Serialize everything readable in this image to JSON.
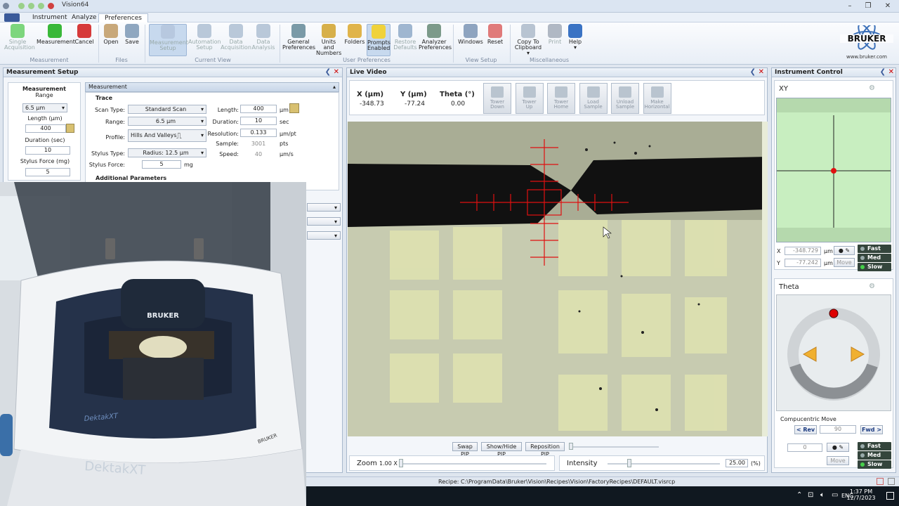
{
  "window": {
    "title": "Vision64"
  },
  "menu": [
    "Instrument",
    "Analyze",
    "Preferences"
  ],
  "ribbon": {
    "buttons": [
      {
        "label": "Single\nAcquisition",
        "color": "#7dd67d",
        "dis": true
      },
      {
        "label": "Measurement",
        "color": "#39b839"
      },
      {
        "label": "Cancel",
        "color": "#d63a3a"
      },
      {
        "label": "Open",
        "color": "#c8a87a"
      },
      {
        "label": "Save",
        "color": "#8fa7c0"
      },
      {
        "label": "Measurement\nSetup",
        "color": "#b7c8df",
        "dis": true,
        "active": true
      },
      {
        "label": "Automation\nSetup",
        "color": "#b9c8d9",
        "dis": true
      },
      {
        "label": "Data\nAcquisition",
        "color": "#b9c8d9",
        "dis": true
      },
      {
        "label": "Data\nAnalysis",
        "color": "#b9c8d9",
        "dis": true
      },
      {
        "label": "General\nPreferences",
        "color": "#7a9aa7"
      },
      {
        "label": "Units and\nNumbers",
        "color": "#d7b04a"
      },
      {
        "label": "Folders",
        "color": "#e0b44a"
      },
      {
        "label": "Prompts\nEnabled",
        "color": "#f0d23a",
        "active": true
      },
      {
        "label": "Restore\nDefaults",
        "color": "#9fb6d0",
        "dis": true
      },
      {
        "label": "Analyzer\nPreferences",
        "color": "#7c9a8a"
      },
      {
        "label": "Windows",
        "color": "#8ea4c0"
      },
      {
        "label": "Reset",
        "color": "#e07a7a"
      },
      {
        "label": "Copy To\nClipboard ▾",
        "color": "#b8c4d2"
      },
      {
        "label": "Print",
        "color": "#b0b8c4",
        "dis": true
      },
      {
        "label": "Help\n▾",
        "color": "#3a73c4"
      }
    ],
    "groups": [
      "Measurement",
      "Files",
      "Current View",
      "User Preferences",
      "View Setup",
      "Miscellaneous"
    ]
  },
  "logo": {
    "text": "BRUKER",
    "url": "www.bruker.com"
  },
  "measurement_setup": {
    "title": "Measurement Setup",
    "side": {
      "title": "Measurement",
      "range_label": "Range",
      "range_value": "6.5 µm",
      "length_label": "Length (µm)",
      "length_value": "400",
      "duration_label": "Duration (sec)",
      "duration_value": "10",
      "stylus_label": "Stylus Force (mg)",
      "stylus_value": "5"
    },
    "section": "Measurement",
    "trace": "Trace",
    "scan_type_label": "Scan Type:",
    "scan_type": "Standard Scan",
    "range_label": "Range:",
    "range": "6.5 µm",
    "profile_label": "Profile:",
    "profile": "Hills And Valleys",
    "stylus_type_label": "Stylus Type:",
    "stylus_type": "Radius: 12.5 µm",
    "stylus_force_label": "Stylus Force:",
    "stylus_force": "5",
    "stylus_force_unit": "mg",
    "length_label": "Length:",
    "length": "400",
    "length_unit": "µm",
    "duration_label": "Duration:",
    "duration": "10",
    "duration_unit": "sec",
    "resolution_label": "Resolution:",
    "resolution": "0.133",
    "resolution_unit": "µm/pt",
    "sample_label": "Sample:",
    "sample": "3001",
    "sample_unit": "pts",
    "speed_label": "Speed:",
    "speed": "40",
    "speed_unit": "µm/s",
    "additional": "Additional Parameters"
  },
  "live_video": {
    "title": "Live Video",
    "x_label": "X (µm)",
    "x": "-348.73",
    "y_label": "Y (µm)",
    "y": "-77.24",
    "theta_label": "Theta (°)",
    "theta": "0.00",
    "tools": [
      "Tower\nDown",
      "Tower\nUp",
      "Tower\nHome",
      "Load\nSample",
      "Unload\nSample",
      "Make\nHorizontal"
    ],
    "swap": "Swap PIP",
    "showhide": "Show/Hide PIP",
    "reposition": "Reposition PIP",
    "zoom_label": "Zoom",
    "zoom": "1.00 X",
    "intensity_label": "Intensity",
    "intensity": "25.00",
    "intensity_unit": "(%)"
  },
  "instrument_control": {
    "title": "Instrument Control",
    "xy": "XY",
    "x_label": "X",
    "x": "-348.729",
    "y_label": "Y",
    "y": "-77.242",
    "unit": "µm",
    "move": "Move",
    "fast": "Fast",
    "med": "Med",
    "slow": "Slow",
    "theta": "Theta",
    "compucentric": "Compucentric Move",
    "rev": "< Rev",
    "angle": "90",
    "fwd": "Fwd >",
    "theta_val": "0"
  },
  "status": {
    "recipe": "Recipe: C:\\ProgramData\\Bruker\\Vision\\Recipes\\Vision\\FactoryRecipes\\DEFAULT.visrcp"
  },
  "taskbar": {
    "lang": "ENG",
    "time": "1:37 PM",
    "date": "12/7/2023"
  },
  "photo": {
    "brand": "BRUKER",
    "model": "DektakXT"
  }
}
